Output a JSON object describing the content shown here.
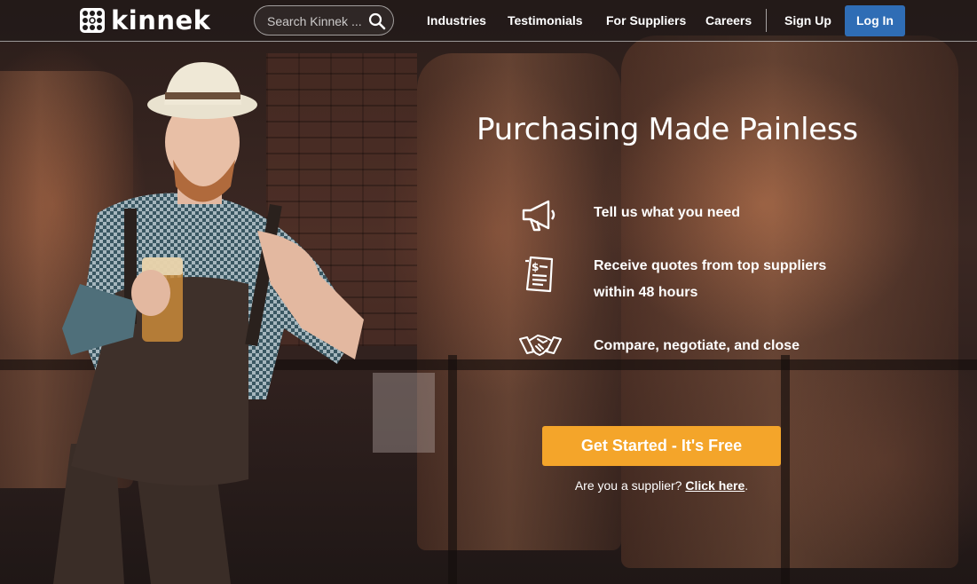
{
  "brand": {
    "name": "Kinnek",
    "logo_text": "kinnek"
  },
  "search": {
    "placeholder": "Search Kinnek ...",
    "value": ""
  },
  "nav": {
    "links": [
      "Industries",
      "Testimonials",
      "For Suppliers",
      "Careers",
      "Sign Up"
    ],
    "login_label": "Log In"
  },
  "hero": {
    "title": "Purchasing Made Painless",
    "steps": [
      {
        "icon": "megaphone-icon",
        "lines": [
          "Tell us what you need"
        ]
      },
      {
        "icon": "quote-document-icon",
        "lines": [
          "Receive quotes from top suppliers",
          "within 48 hours"
        ]
      },
      {
        "icon": "handshake-icon",
        "lines": [
          "Compare, negotiate, and close"
        ]
      }
    ],
    "cta_label": "Get Started - It's Free",
    "supplier_prompt": "Are you a supplier?",
    "supplier_link": "Click here",
    "supplier_suffix": "."
  },
  "colors": {
    "cta": "#f4a52a",
    "login": "#2f6db5",
    "text": "#ffffff"
  }
}
